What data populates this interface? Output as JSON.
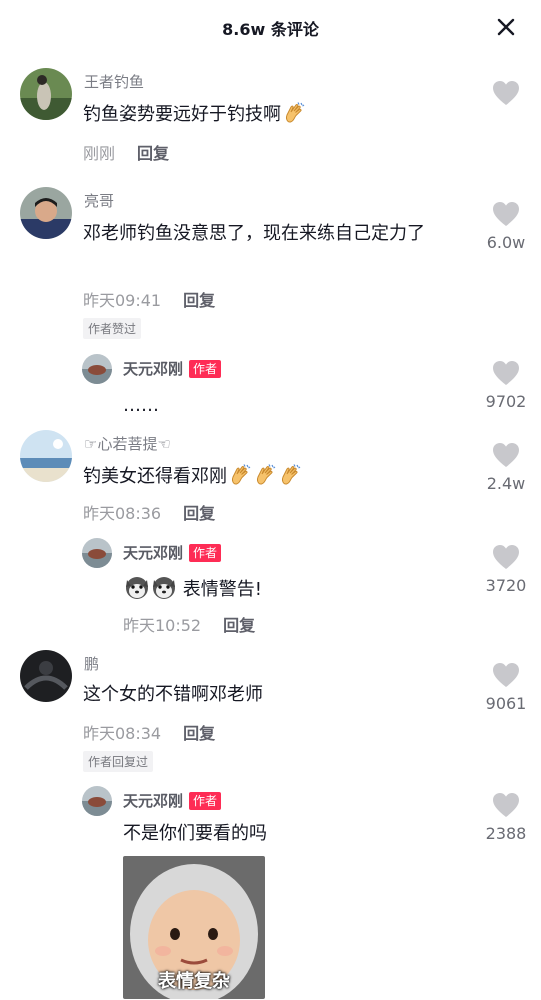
{
  "header": {
    "title": "8.6w 条评论",
    "close_icon": "close-icon"
  },
  "comments": [
    {
      "username": "王者钓鱼",
      "text": "钓鱼姿势要远好于钓技啊",
      "time": "刚刚",
      "reply_label": "回复",
      "likes": ""
    },
    {
      "username": "亮哥",
      "text": "邓老师钓鱼没意思了，现在来练自己定力了",
      "time": "昨天09:41",
      "reply_label": "回复",
      "likes": "6.0w",
      "tag": "作者赞过",
      "reply": {
        "username": "天元邓刚",
        "badge": "作者",
        "text": "……",
        "likes": "9702"
      }
    },
    {
      "username": "☞心若菩提☜",
      "text": "钓美女还得看邓刚",
      "time": "昨天08:36",
      "reply_label": "回复",
      "likes": "2.4w",
      "reply": {
        "username": "天元邓刚",
        "badge": "作者",
        "text": "表情警告!",
        "time": "昨天10:52",
        "reply_label": "回复",
        "likes": "3720"
      }
    },
    {
      "username": "鹏",
      "text": "这个女的不错啊邓老师",
      "time": "昨天08:34",
      "reply_label": "回复",
      "likes": "9061",
      "tag": "作者回复过",
      "reply": {
        "username": "天元邓刚",
        "badge": "作者",
        "text": "不是你们要看的吗",
        "likes": "2388",
        "sticker_caption": "表情复杂"
      }
    }
  ],
  "colors": {
    "badge": "#fe2c55",
    "text": "#161823",
    "muted": "#9a9ba0",
    "like": "#c8c8cc"
  }
}
